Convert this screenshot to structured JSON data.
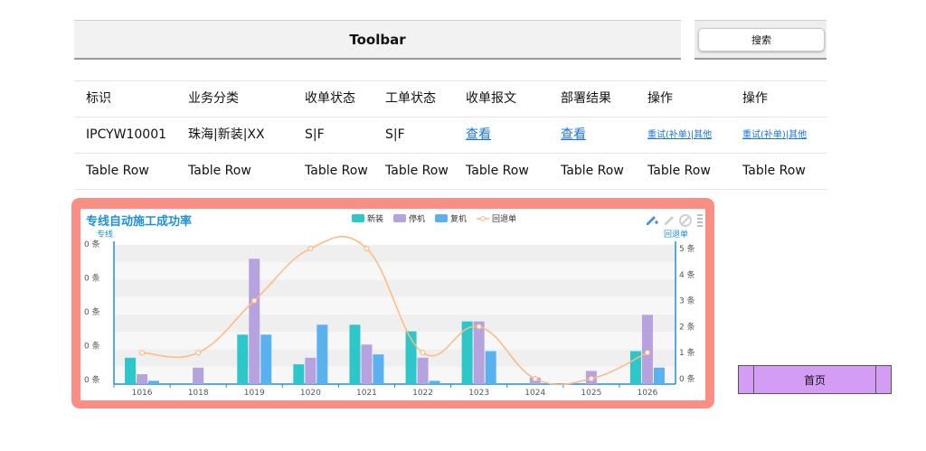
{
  "toolbar": {
    "title": "Toolbar",
    "search_label": "搜索"
  },
  "table": {
    "headers": [
      "标识",
      "业务分类",
      "收单状态",
      "工单状态",
      "收单报文",
      "部署结果",
      "操作",
      "操作"
    ],
    "rows": [
      [
        "IPCYW10001",
        "珠海|新装|XX",
        "S|F",
        "S|F",
        "查看",
        "查看",
        "重试(补单)|其他",
        "重试(补单)|其他"
      ],
      [
        "Table Row",
        "Table Row",
        "Table Row",
        "Table Row",
        "Table Row",
        "Table Row",
        "Table Row",
        "Table Row"
      ]
    ]
  },
  "chart_data": {
    "type": "bar",
    "title": "专线自动施工成功率",
    "ylabel": "专线",
    "y2label": "回退单",
    "categories": [
      "1016",
      "1018",
      "1019",
      "1020",
      "1021",
      "1022",
      "1023",
      "1024",
      "1025",
      "1026"
    ],
    "y_ticks_left": [
      "0 条",
      "0 条",
      "0 条",
      "0 条",
      "0 条"
    ],
    "y_ticks_right": [
      "0 条",
      "1 条",
      "2 条",
      "3 条",
      "4 条",
      "5 条"
    ],
    "y2lim": [
      0,
      5
    ],
    "series": [
      {
        "name": "新装",
        "type": "bar",
        "color": "#2ec7c9",
        "values": [
          8,
          0,
          15,
          6,
          18,
          16,
          19,
          0,
          0,
          10
        ]
      },
      {
        "name": "停机",
        "type": "bar",
        "color": "#b6a2de",
        "values": [
          3,
          5,
          38,
          8,
          12,
          8,
          19,
          2,
          4,
          21
        ]
      },
      {
        "name": "复机",
        "type": "bar",
        "color": "#5ab1ef",
        "values": [
          1,
          0,
          15,
          18,
          9,
          1,
          10,
          0,
          0,
          5
        ]
      },
      {
        "name": "回退单",
        "type": "line",
        "color": "#ffb980",
        "values": [
          1,
          1,
          3,
          5,
          5,
          1,
          2,
          0,
          0,
          1
        ]
      }
    ],
    "ylim": [
      0,
      40
    ],
    "legend": "top-center"
  },
  "nav": {
    "home_label": "首页"
  }
}
